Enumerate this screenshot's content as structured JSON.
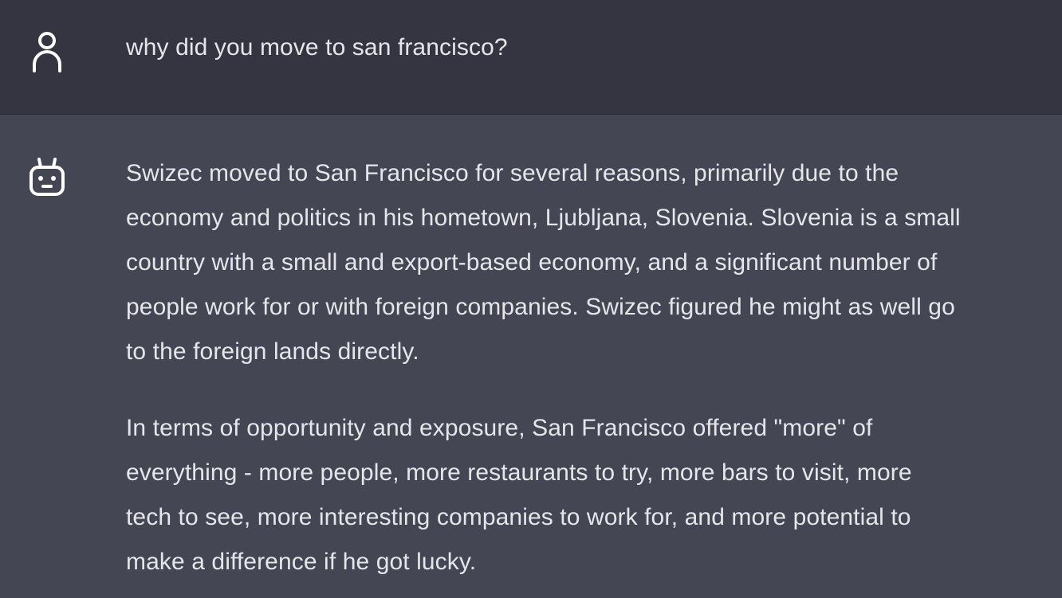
{
  "conversation": {
    "user_message": {
      "role_icon": "user-icon",
      "text": "why did you move to san francisco?"
    },
    "bot_message": {
      "role_icon": "robot-icon",
      "paragraphs": [
        {
          "lines": [
            "Swizec moved to San Francisco for several reasons, primarily due to the",
            "economy and politics in his hometown, Ljubljana, Slovenia. Slovenia is a small",
            "country with a small and export-based economy, and a significant number of",
            "people work for or with foreign companies. Swizec figured he might as well go",
            "to the foreign lands directly."
          ]
        },
        {
          "lines": [
            "In terms of opportunity and exposure, San Francisco offered \"more\" of",
            "everything - more people, more restaurants to try, more bars to visit, more",
            "tech to see, more interesting companies to work for, and more potential to",
            "make a difference if he got lucky."
          ]
        }
      ]
    }
  },
  "colors": {
    "user_bg": "#343541",
    "bot_bg": "#444654",
    "text": "#e5e6ea"
  }
}
